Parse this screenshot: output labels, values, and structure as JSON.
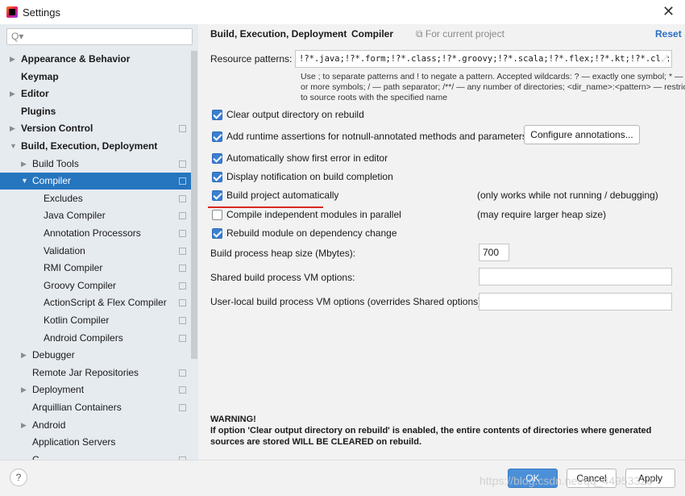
{
  "window": {
    "title": "Settings",
    "close": "✕"
  },
  "sidebar": {
    "search_placeholder": "Q▾",
    "items": [
      {
        "label": "Appearance & Behavior",
        "level": 0,
        "bold": true,
        "arrow": "right",
        "copy": false
      },
      {
        "label": "Keymap",
        "level": 0,
        "bold": true,
        "arrow": "",
        "copy": false
      },
      {
        "label": "Editor",
        "level": 0,
        "bold": true,
        "arrow": "right",
        "copy": false
      },
      {
        "label": "Plugins",
        "level": 0,
        "bold": true,
        "arrow": "",
        "copy": false
      },
      {
        "label": "Version Control",
        "level": 0,
        "bold": true,
        "arrow": "right",
        "copy": true
      },
      {
        "label": "Build, Execution, Deployment",
        "level": 0,
        "bold": true,
        "arrow": "down",
        "copy": false
      },
      {
        "label": "Build Tools",
        "level": 1,
        "arrow": "right",
        "copy": true
      },
      {
        "label": "Compiler",
        "level": 1,
        "arrow": "down",
        "copy": true,
        "selected": true
      },
      {
        "label": "Excludes",
        "level": 2,
        "arrow": "",
        "copy": true
      },
      {
        "label": "Java Compiler",
        "level": 2,
        "arrow": "",
        "copy": true
      },
      {
        "label": "Annotation Processors",
        "level": 2,
        "arrow": "",
        "copy": true
      },
      {
        "label": "Validation",
        "level": 2,
        "arrow": "",
        "copy": true
      },
      {
        "label": "RMI Compiler",
        "level": 2,
        "arrow": "",
        "copy": true
      },
      {
        "label": "Groovy Compiler",
        "level": 2,
        "arrow": "",
        "copy": true
      },
      {
        "label": "ActionScript & Flex Compiler",
        "level": 2,
        "arrow": "",
        "copy": true
      },
      {
        "label": "Kotlin Compiler",
        "level": 2,
        "arrow": "",
        "copy": true
      },
      {
        "label": "Android Compilers",
        "level": 2,
        "arrow": "",
        "copy": true
      },
      {
        "label": "Debugger",
        "level": 1,
        "arrow": "right",
        "copy": false
      },
      {
        "label": "Remote Jar Repositories",
        "level": 1,
        "arrow": "",
        "copy": true
      },
      {
        "label": "Deployment",
        "level": 1,
        "arrow": "right",
        "copy": true
      },
      {
        "label": "Arquillian Containers",
        "level": 1,
        "arrow": "",
        "copy": true
      },
      {
        "label": "Android",
        "level": 1,
        "arrow": "right",
        "copy": false
      },
      {
        "label": "Application Servers",
        "level": 1,
        "arrow": "",
        "copy": false
      },
      {
        "label": "C",
        "level": 1,
        "arrow": "",
        "copy": true
      }
    ]
  },
  "header": {
    "crumb1": "Build, Execution, Deployment",
    "sep": "›",
    "crumb2": "Compiler",
    "scope": "For current project",
    "reset": "Reset"
  },
  "resource": {
    "label": "Resource patterns:",
    "value": "!?*.java;!?*.form;!?*.class;!?*.groovy;!?*.scala;!?*.flex;!?*.kt;!?*.clj;!?*.aj",
    "help1": "Use ; to separate patterns and ! to negate a pattern. Accepted wildcards: ? — exactly one symbol; * — zero",
    "help2": "or more symbols; / — path separator; /**/ — any number of directories; <dir_name>:<pattern> — restrict",
    "help3": "to source roots with the specified name"
  },
  "options": [
    {
      "label": "Clear output directory on rebuild",
      "checked": true
    },
    {
      "label": "Add runtime assertions for notnull-annotated methods and parameters",
      "checked": true
    },
    {
      "label": "Automatically show first error in editor",
      "checked": true
    },
    {
      "label": "Display notification on build completion",
      "checked": true
    },
    {
      "label": "Build project automatically",
      "checked": true,
      "note": "(only works while not running / debugging)"
    },
    {
      "label": "Compile independent modules in parallel",
      "checked": false,
      "note": "(may require larger heap size)"
    },
    {
      "label": "Rebuild module on dependency change",
      "checked": true
    }
  ],
  "configure_button": "Configure annotations...",
  "heap": {
    "label": "Build process heap size (Mbytes):",
    "value": "700"
  },
  "shared_vm": {
    "label": "Shared build process VM options:",
    "value": ""
  },
  "user_vm": {
    "label": "User-local build process VM options (overrides Shared options):",
    "value": ""
  },
  "warning": {
    "title": "WARNING!",
    "line1": "If option 'Clear output directory on rebuild' is enabled, the entire contents of directories where generated",
    "line2": "sources are stored WILL BE CLEARED on rebuild."
  },
  "footer": {
    "help": "?",
    "ok": "OK",
    "cancel": "Cancel",
    "apply": "Apply",
    "watermark": "https://blog.csdn.net/qq_44953320"
  },
  "colors": {
    "selection": "#2675bf",
    "accent": "#3a7fd0",
    "underline": "#d9281e"
  }
}
